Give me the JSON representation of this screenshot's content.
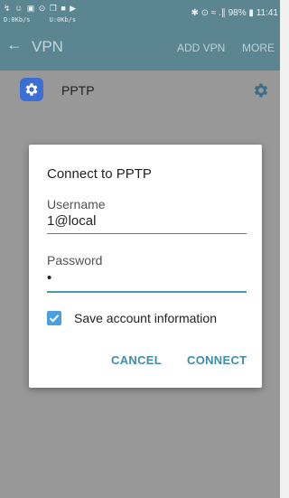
{
  "status_bar": {
    "left_icons": "↯ ☺ ▣ ⊙ ❐ ■ ▶",
    "net_speed": "D:0Kb/s     U:0Kb/s",
    "right_icons": "✱ ⊙ ≈ .∥",
    "battery": "98%",
    "time": "11:41"
  },
  "app_bar": {
    "title": "VPN",
    "actions": [
      {
        "label": "ADD VPN"
      },
      {
        "label": "MORE"
      }
    ]
  },
  "vpn_list": {
    "items": [
      {
        "label": "PPTP",
        "icon": "settings-icon"
      }
    ]
  },
  "dialog": {
    "title": "Connect to PPTP",
    "username_label": "Username",
    "username_value": "1@local",
    "password_label": "Password",
    "password_value": "•",
    "save_checkbox_label": "Save account information",
    "save_checked": true,
    "cancel_label": "CANCEL",
    "connect_label": "CONNECT"
  },
  "colors": {
    "app_bar": "#5a8591",
    "dim_overlay": "#989898",
    "accent": "#3f8ea6",
    "checkbox": "#4a9fe0",
    "vpn_icon": "#3b6fd3"
  }
}
